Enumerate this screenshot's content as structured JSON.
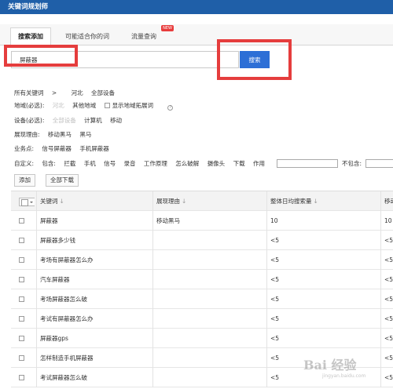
{
  "app": {
    "title": "关键词规划师"
  },
  "tabs": [
    {
      "label": "搜索添加"
    },
    {
      "label": "可能适合你的词"
    },
    {
      "label": "流量查询",
      "badge": "NEW"
    }
  ],
  "search": {
    "value": "屏蔽器",
    "button_label": "搜索"
  },
  "breadcrumb": {
    "root": "所有关键词",
    "sep": ">",
    "region": "河北",
    "device": "全部设备"
  },
  "filters": {
    "region_label": "地域(必选):",
    "region_options": [
      "河北",
      "其他地域"
    ],
    "show_region_ext": "显示地域拓展词",
    "device_label": "设备(必选):",
    "device_options": [
      "全部设备",
      "计算机",
      "移动"
    ],
    "reason_label": "展现理由:",
    "reason_options": [
      "移动黑马",
      "黑马"
    ],
    "business_label": "业务点:",
    "business_options": [
      "信号屏蔽器",
      "手机屏蔽器"
    ],
    "custom_label": "自定义:",
    "include_label": "包含:",
    "include_terms": [
      "拦截",
      "手机",
      "信号",
      "录音",
      "工作原理",
      "怎么破解",
      "摄像头",
      "下载",
      "作用"
    ],
    "exclude_label": "不包含:"
  },
  "actions": {
    "add": "添加",
    "download_all": "全部下载"
  },
  "table": {
    "headers": [
      "关键词",
      "展现理由",
      "整体日均搜索量",
      "移动"
    ],
    "sort_glyph": "↓",
    "rows": [
      [
        "屏蔽器",
        "移动黑马",
        "10",
        "10"
      ],
      [
        "屏蔽器多少钱",
        "",
        "<5",
        "<5"
      ],
      [
        "考场有屏蔽器怎么办",
        "",
        "<5",
        "<5"
      ],
      [
        "汽车屏蔽器",
        "",
        "<5",
        "<5"
      ],
      [
        "考场屏蔽器怎么破",
        "",
        "<5",
        "<5"
      ],
      [
        "考试有屏蔽器怎么办",
        "",
        "<5",
        "<5"
      ],
      [
        "屏蔽器gps",
        "",
        "<5",
        "<5"
      ],
      [
        "怎样制造手机屏蔽器",
        "",
        "<5",
        "<5"
      ],
      [
        "考试屏蔽器怎么破",
        "",
        "<5",
        "<5"
      ]
    ]
  },
  "colors": {
    "titlebar": "#1f5fa8",
    "search_button": "#2d6fd6",
    "highlight": "#e53d3d"
  },
  "watermark": {
    "text": "Bai 经验",
    "sub": "jingyan.baidu.com"
  }
}
